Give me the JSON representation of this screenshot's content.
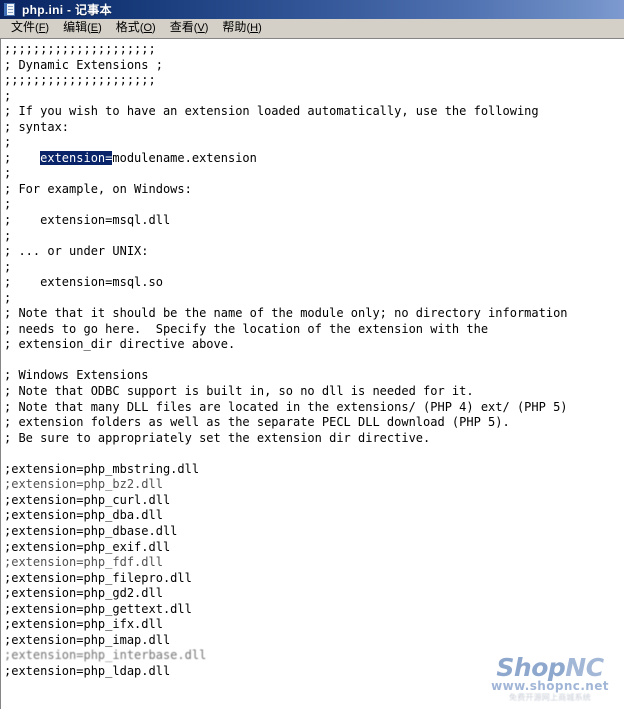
{
  "window": {
    "title": "php.ini - 记事本",
    "icon": "notepad-icon"
  },
  "menubar": {
    "items": [
      {
        "label": "文件",
        "accel": "F",
        "accel_text": "(F)"
      },
      {
        "label": "编辑",
        "accel": "E",
        "accel_text": "(E)"
      },
      {
        "label": "格式",
        "accel": "O",
        "accel_text": "(O)"
      },
      {
        "label": "查看",
        "accel": "V",
        "accel_text": "(V)"
      },
      {
        "label": "帮助",
        "accel": "H",
        "accel_text": "(H)"
      }
    ]
  },
  "editor": {
    "selection": {
      "text": "extension=",
      "background": "#0a246a",
      "foreground": "#ffffff"
    },
    "lines": [
      ";;;;;;;;;;;;;;;;;;;;;",
      "; Dynamic Extensions ;",
      ";;;;;;;;;;;;;;;;;;;;;",
      ";",
      "; If you wish to have an extension loaded automatically, use the following",
      "; syntax:",
      ";",
      ";    extension=modulename.extension",
      ";",
      "; For example, on Windows:",
      ";",
      ";    extension=msql.dll",
      ";",
      "; ... or under UNIX:",
      ";",
      ";    extension=msql.so",
      ";",
      "; Note that it should be the name of the module only; no directory information",
      "; needs to go here.  Specify the location of the extension with the",
      "; extension_dir directive above.",
      "",
      "; Windows Extensions",
      "; Note that ODBC support is built in, so no dll is needed for it.",
      "; Note that many DLL files are located in the extensions/ (PHP 4) ext/ (PHP 5)",
      "; extension folders as well as the separate PECL DLL download (PHP 5).",
      "; Be sure to appropriately set the extension dir directive.",
      "",
      ";extension=php_mbstring.dll",
      ";extension=php_bz2.dll",
      ";extension=php_curl.dll",
      ";extension=php_dba.dll",
      ";extension=php_dbase.dll",
      ";extension=php_exif.dll",
      ";extension=php_fdf.dll",
      ";extension=php_filepro.dll",
      ";extension=php_gd2.dll",
      ";extension=php_gettext.dll",
      ";extension=php_ifx.dll",
      ";extension=php_imap.dll",
      ";extension=php_interbase.dll",
      ";extension=php_ldap.dll"
    ]
  },
  "watermark": {
    "logo_shop": "Shop",
    "logo_nc": "NC",
    "url": "www.shopnc.net",
    "subtitle": "免费开源网上商城系统",
    "color": "#7d9ac8"
  }
}
